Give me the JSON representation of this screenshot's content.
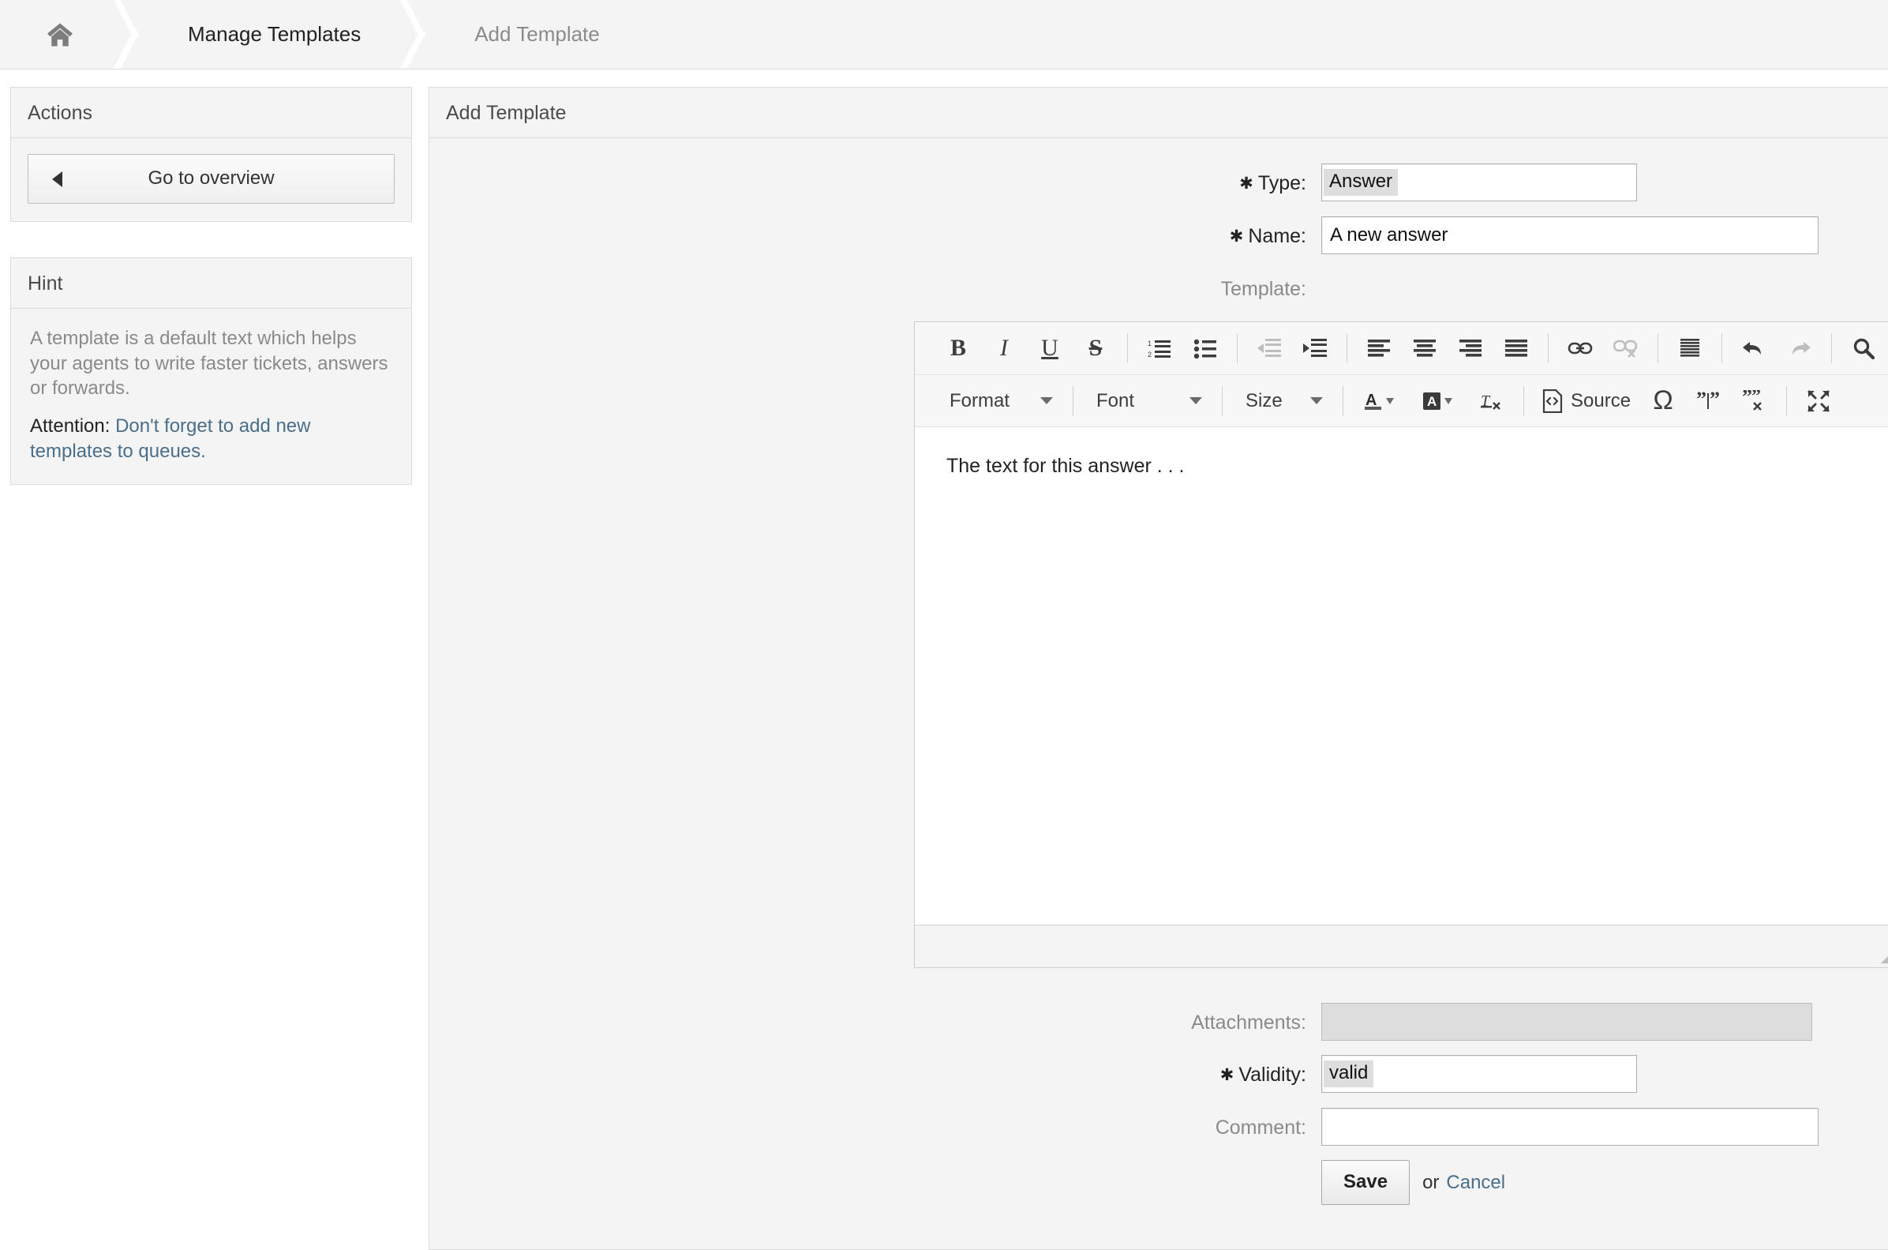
{
  "breadcrumb": {
    "home_icon": "home-icon",
    "items": [
      {
        "label": "Manage Templates",
        "active": true
      },
      {
        "label": "Add Template",
        "active": false
      }
    ]
  },
  "sidebar": {
    "actions": {
      "title": "Actions",
      "go_to_overview": "Go to overview"
    },
    "hint": {
      "title": "Hint",
      "text": "A template is a default text which helps your agents to write faster tickets, answers or forwards.",
      "attention_label": "Attention:",
      "attention_link": "Don't forget to add new templates to queues."
    }
  },
  "main": {
    "title": "Add Template",
    "fields": {
      "type_label": "Type:",
      "type_value": "Answer",
      "name_label": "Name:",
      "name_value": "A new answer",
      "template_label": "Template:",
      "attachments_label": "Attachments:",
      "attachments_value": "",
      "validity_label": "Validity:",
      "validity_value": "valid",
      "comment_label": "Comment:",
      "comment_value": ""
    },
    "editor": {
      "content": "The text for this answer . . .",
      "toolbar_row1": [
        {
          "name": "bold-icon",
          "label": "B",
          "disabled": false
        },
        {
          "name": "italic-icon",
          "label": "I",
          "disabled": false
        },
        {
          "name": "underline-icon",
          "label": "U",
          "disabled": false
        },
        {
          "name": "strikethrough-icon",
          "label": "S",
          "disabled": false
        },
        {
          "name": "numbered-list-icon",
          "label": "",
          "disabled": false
        },
        {
          "name": "bulleted-list-icon",
          "label": "",
          "disabled": false
        },
        {
          "name": "outdent-icon",
          "label": "",
          "disabled": true
        },
        {
          "name": "indent-icon",
          "label": "",
          "disabled": false
        },
        {
          "name": "align-left-icon",
          "label": "",
          "disabled": false
        },
        {
          "name": "align-center-icon",
          "label": "",
          "disabled": false
        },
        {
          "name": "align-right-icon",
          "label": "",
          "disabled": false
        },
        {
          "name": "align-justify-icon",
          "label": "",
          "disabled": false
        },
        {
          "name": "link-icon",
          "label": "",
          "disabled": false
        },
        {
          "name": "unlink-icon",
          "label": "",
          "disabled": true
        },
        {
          "name": "blockquote-lines-icon",
          "label": "",
          "disabled": false
        },
        {
          "name": "undo-icon",
          "label": "",
          "disabled": false
        },
        {
          "name": "redo-icon",
          "label": "",
          "disabled": true
        },
        {
          "name": "find-icon",
          "label": "",
          "disabled": false
        }
      ],
      "format_combo": "Format",
      "font_combo": "Font",
      "size_combo": "Size",
      "text_color_icon": "text-color-icon",
      "bg_color_icon": "background-color-icon",
      "remove_format_icon": "remove-format-icon",
      "source_label": "Source",
      "special_char_icon": "omega-special-character-icon",
      "split_quote_icon": "split-quote-icon",
      "remove_quote_icon": "remove-quote-icon",
      "maximize_icon": "maximize-icon"
    },
    "save_label": "Save",
    "or_label": "or",
    "cancel_label": "Cancel"
  },
  "colors": {
    "link": "#4a6e8a",
    "panel_bg": "#f4f4f4",
    "border": "#dcdcdc",
    "highlight": "#dedede"
  }
}
